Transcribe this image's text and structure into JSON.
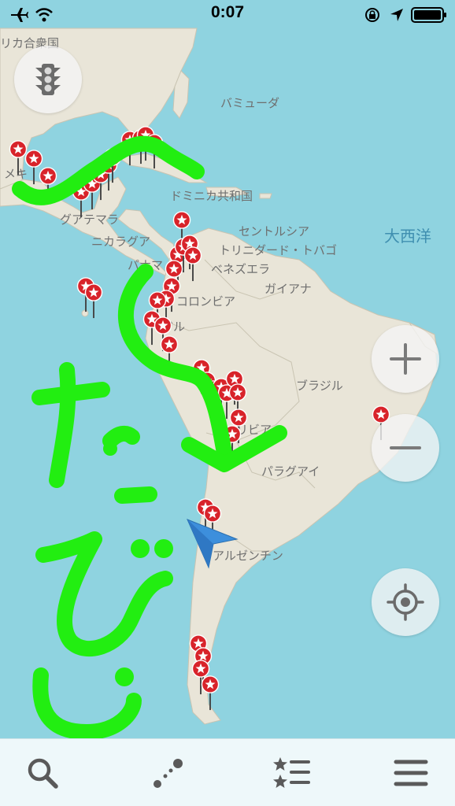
{
  "status_bar": {
    "time": "0:07",
    "left_icons": [
      "airplane-mode-icon",
      "wifi-icon"
    ],
    "right_icons": [
      "orientation-lock-icon",
      "location-arrow-icon",
      "battery-icon"
    ]
  },
  "map": {
    "country_labels": {
      "usa_partial": "リカ合衆国",
      "bermuda": "バミューダ",
      "dominican": "ドミニカ共和国",
      "saint_lucia": "セントルシア",
      "trinidad": "トリニダード・トバゴ",
      "venezuela": "ベネズエラ",
      "guyana": "ガイアナ",
      "guatemala": "グアテマラ",
      "nicaragua": "ニカラグア",
      "panama": "パナマ",
      "colombia": "コロンビア",
      "brazil_partial": "ジル",
      "brazil": "ブラジル",
      "bolivia_partial": "リビア",
      "paraguay": "パラグアイ",
      "argentina": "アルゼンチン",
      "mexico_partial": "メキ"
    },
    "ocean_label": "大西洋",
    "handwritten_overlay": "たこびじ",
    "bookmark_count": 42
  },
  "controls": {
    "traffic": "traffic-light-icon",
    "zoom_in": "plus-icon",
    "zoom_out": "minus-icon",
    "my_location": "crosshair-icon"
  },
  "toolbar": {
    "items": [
      "search-icon",
      "route-icon",
      "bookmarks-icon",
      "menu-icon"
    ]
  },
  "colors": {
    "ocean": "#8fd3e0",
    "land": "#e9e5d8",
    "pin": "#d8232a",
    "overlay_green": "#22ee11",
    "position_arrow": "#3d8fdc"
  }
}
